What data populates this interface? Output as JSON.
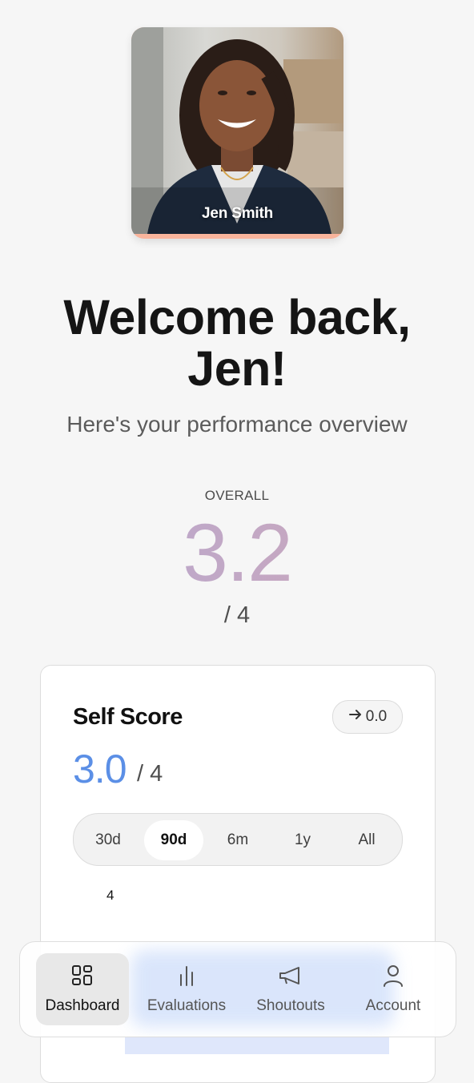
{
  "profile": {
    "name": "Jen Smith"
  },
  "welcome": {
    "title": "Welcome back, Jen!",
    "subtitle": "Here's your performance overview"
  },
  "overall": {
    "label": "OVERALL",
    "value": "3.2",
    "max": "/ 4"
  },
  "self_score": {
    "title": "Self Score",
    "trend": "0.0",
    "trend_icon": "arrow-right-icon",
    "value": "3.0",
    "max": "/ 4",
    "ranges": [
      "30d",
      "90d",
      "6m",
      "1y",
      "All"
    ],
    "active_range": "90d",
    "axis_tick": "4"
  },
  "colors": {
    "accent_blue": "#5b8fe6",
    "overall_gradient_start": "#b5a8d3",
    "overall_gradient_end": "#cfa7b7",
    "profile_accent": "#f9b49c"
  },
  "nav": {
    "items": [
      {
        "label": "Dashboard",
        "icon": "dashboard-icon",
        "active": true
      },
      {
        "label": "Evaluations",
        "icon": "bar-chart-icon",
        "active": false
      },
      {
        "label": "Shoutouts",
        "icon": "megaphone-icon",
        "active": false
      },
      {
        "label": "Account",
        "icon": "user-icon",
        "active": false
      }
    ]
  }
}
